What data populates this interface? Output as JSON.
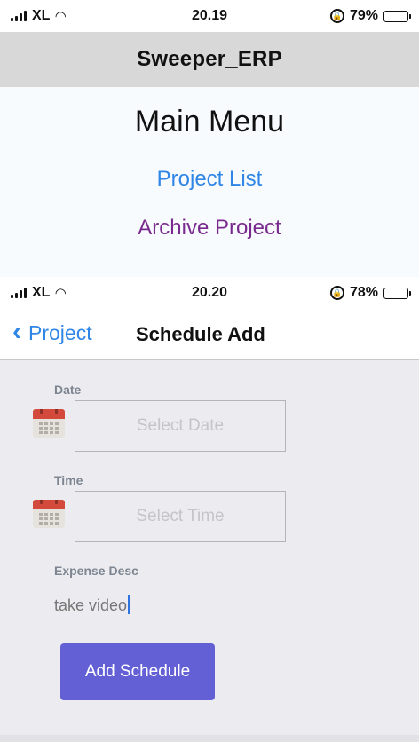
{
  "status_top": {
    "carrier": "XL",
    "time": "20.19",
    "battery": "79%",
    "battery_level": 0.79
  },
  "header": {
    "title": "Sweeper_ERP"
  },
  "main_menu": {
    "title": "Main Menu",
    "items": [
      {
        "label": "Project List",
        "color": "#2f86e6"
      },
      {
        "label": "Archive Project",
        "color": "#7a2a8f"
      }
    ]
  },
  "status_bottom": {
    "carrier": "XL",
    "time": "20.20",
    "battery": "78%",
    "battery_level": 0.78
  },
  "nav": {
    "back_label": "Project",
    "title": "Schedule Add"
  },
  "form": {
    "date": {
      "label": "Date",
      "placeholder": "Select Date",
      "icon": "calendar-icon"
    },
    "time": {
      "label": "Time",
      "placeholder": "Select Time",
      "icon": "calendar-icon"
    },
    "expense": {
      "label": "Expense Desc",
      "value": "take video"
    },
    "submit_label": "Add Schedule"
  },
  "colors": {
    "accent": "#6360d5",
    "link": "#2f86e6",
    "archive": "#7a2a8f",
    "header_bg": "#d8d8d8"
  }
}
